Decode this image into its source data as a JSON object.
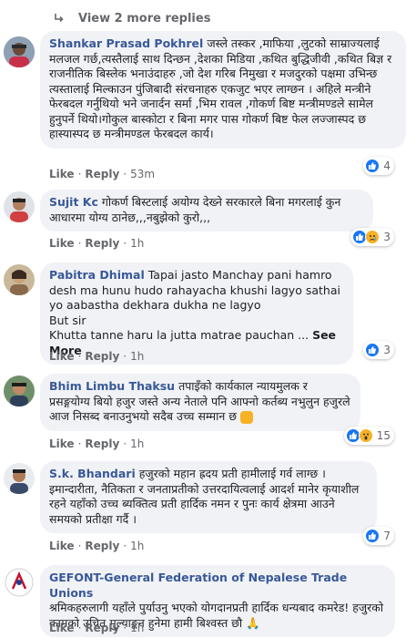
{
  "more_replies": {
    "label": "View 2 more replies"
  },
  "comments": [
    {
      "name": "Shankar Prasad Pokhrel",
      "text": "जस्ले तस्कर ,माफिया ,लुटको साम्राज्यलाई मलजल गर्छ,त्यस्तैलाई साथ दिन्छन ,देशका मिडिया ,कथित बुद्धिजीवी ,कथित बिज्ञ र राजनीतिक बिस्लेक भनाउंदाहरु ,जो देश गरिब निमुखा र मजदुरको पक्षमा उभिन्छ त्यस्तालाई मिल्काउन पुंजिबादी संरचनाहरु एकजुट भएर लाग्छन । अहिले मन्त्रीने फेरबदल गर्नुथियो भने जनार्दन सर्मा ,भिम रावल ,गोकर्ण बिष्ट मन्त्रीमण्डले सामेल हुनुपर्ने थियो।गोकुल बास्कोटा र बिना मगर पास गोकर्ण बिष्ट फेल लज्जास्पद छ हास्यास्पद छ मन्त्रीमण्डल फेरबदल कार्य।",
      "like": "Like",
      "reply": "Reply",
      "time": "53m",
      "reactions": {
        "count": "4"
      }
    },
    {
      "name": "Sujit Kc",
      "text": "गोकर्ण बिस्टलाई अयोग्य देख्ने सरकारले बिना मगरलाई कुन आधारमा योग्य ठानेछ,,,नबुझेको कुरो,,,",
      "like": "Like",
      "reply": "Reply",
      "time": "1h",
      "reactions": {
        "count": "3"
      }
    },
    {
      "name": "Pabitra Dhimal",
      "text": "Tapai jasto Manchay pani hamro desh ma hunu hudo rahayacha khushi lagyo sathai yo aabastha dekhara dukha ne lagyo\nBut sir\nKhutta tanne haru la jutta matrae pauchan ... ",
      "see_more": "See More",
      "like": "Like",
      "reply": "Reply",
      "time": "1h",
      "reactions": {
        "count": "3"
      }
    },
    {
      "name": "Bhim Limbu Thaksu",
      "text": "तपाइँको कार्यकाल न्यायमुलक र प्रसङ्गयोग्य बियो हजुर जस्ते अन्य नेताले पनि आफ्नो कर्तब्य नभुलुन हजुरले आज निसब्द बनाउनुभयो सदैब उच्च सम्मान छ ",
      "like": "Like",
      "reply": "Reply",
      "time": "1h",
      "reactions": {
        "count": "15"
      }
    },
    {
      "name": "S.k. Bhandari",
      "text": "हजुरको महान ह्रदय प्रती हामीलाई गर्व लाग्छ । इमान्दारीता, नैतिकता र जनताप्रतीको उत्तरदायित्वलाई आदर्श मानेर कृयाशील रहने यहाँको उच्च ब्यक्तित्व प्रती हार्दिक नमन र पुनः कार्य क्षेत्रमा आउने समयको प्रतीक्षा गर्दै ।",
      "like": "Like",
      "reply": "Reply",
      "time": "1h",
      "reactions": {
        "count": "7"
      }
    },
    {
      "name": "GEFONT-General Federation of Nepalese Trade Unions",
      "text": "श्रमिकहरुलागी यहाँले पुर्याउनु भएको योगदानप्रती हार्दिक धन्यबाद कमरेड! हजुरको कामको उचित मुल्याङ्कन हुनेमा हामी बिश्वस्त छौ 🙏",
      "like": "Like",
      "reply": "Reply",
      "time": "1h",
      "reactions": {
        "count": ""
      }
    }
  ],
  "colors": {
    "name": "#385898",
    "bubble": "#f0f2f5",
    "meta": "#65676b",
    "like": "#1877f2"
  }
}
